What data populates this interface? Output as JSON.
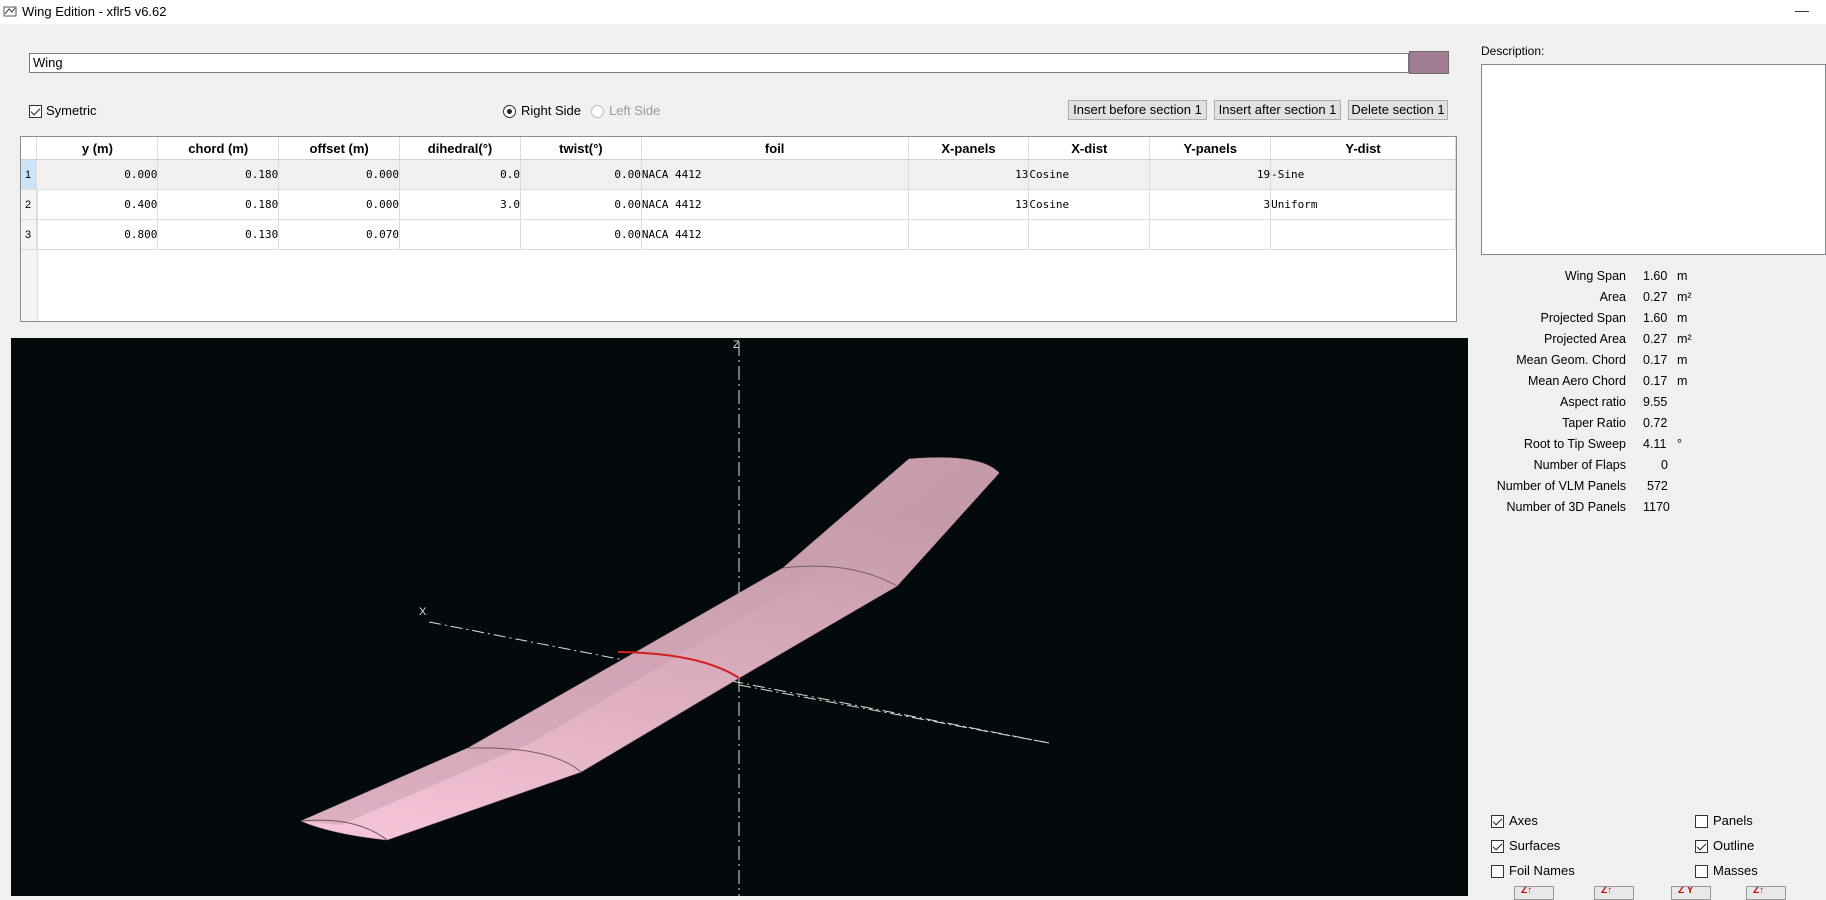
{
  "window": {
    "title": "Wing Edition - xflr5 v6.62",
    "close_glyph": "—"
  },
  "wing": {
    "name": "Wing",
    "color": "#a27c92"
  },
  "symmetry": {
    "symetric_label": "Symetric",
    "symetric_checked": true,
    "right_side_label": "Right Side",
    "left_side_label": "Left Side"
  },
  "buttons": {
    "insert_before": "Insert before section 1",
    "insert_after": "Insert after section 1",
    "delete": "Delete section 1"
  },
  "table": {
    "columns": [
      "y (m)",
      "chord (m)",
      "offset (m)",
      "dihedral(°)",
      "twist(°)",
      "foil",
      "X-panels",
      "X-dist",
      "Y-panels",
      "Y-dist"
    ],
    "rows": [
      {
        "n": "1",
        "y": "0.000",
        "chord": "0.180",
        "offset": "0.000",
        "dihedral": "0.0",
        "twist": "0.00",
        "foil": "NACA 4412",
        "xpanels": "13",
        "xdist": "Cosine",
        "ypanels": "19",
        "ydist": "-Sine"
      },
      {
        "n": "2",
        "y": "0.400",
        "chord": "0.180",
        "offset": "0.000",
        "dihedral": "3.0",
        "twist": "0.00",
        "foil": "NACA 4412",
        "xpanels": "13",
        "xdist": "Cosine",
        "ypanels": "3",
        "ydist": "Uniform"
      },
      {
        "n": "3",
        "y": "0.800",
        "chord": "0.130",
        "offset": "0.070",
        "dihedral": "",
        "twist": "0.00",
        "foil": "NACA 4412",
        "xpanels": "",
        "xdist": "",
        "ypanels": "",
        "ydist": ""
      }
    ]
  },
  "viewport": {
    "axis_x_label": "X",
    "axis_z_label": "Z",
    "wing_color": "#eab6cb",
    "root_section_color": "#d21f1f"
  },
  "description": {
    "label": "Description:",
    "text": ""
  },
  "properties": [
    {
      "label": "Wing Span",
      "value": "1.60",
      "unit": "m"
    },
    {
      "label": "Area",
      "value": "0.27",
      "unit": "m²"
    },
    {
      "label": "Projected Span",
      "value": "1.60",
      "unit": "m"
    },
    {
      "label": "Projected Area",
      "value": "0.27",
      "unit": "m²"
    },
    {
      "label": "Mean Geom. Chord",
      "value": "0.17",
      "unit": "m"
    },
    {
      "label": "Mean Aero Chord",
      "value": "0.17",
      "unit": "m"
    },
    {
      "label": "Aspect ratio",
      "value": "9.55",
      "unit": ""
    },
    {
      "label": "Taper Ratio",
      "value": "0.72",
      "unit": ""
    },
    {
      "label": "Root to Tip Sweep",
      "value": "4.11",
      "unit": "°"
    },
    {
      "label": "Number of Flaps",
      "value": "0",
      "unit": ""
    },
    {
      "label": "Number of VLM Panels",
      "value": "572",
      "unit": ""
    },
    {
      "label": "Number of 3D Panels",
      "value": "1170",
      "unit": ""
    }
  ],
  "options": {
    "axes": {
      "label": "Axes",
      "checked": true
    },
    "surfaces": {
      "label": "Surfaces",
      "checked": true
    },
    "foil_names": {
      "label": "Foil Names",
      "checked": false
    },
    "panels": {
      "label": "Panels",
      "checked": false
    },
    "outline": {
      "label": "Outline",
      "checked": true
    },
    "masses": {
      "label": "Masses",
      "checked": false
    }
  },
  "view_buttons": [
    "Z↑",
    "Z↑",
    "Z Y",
    "Z↑"
  ]
}
